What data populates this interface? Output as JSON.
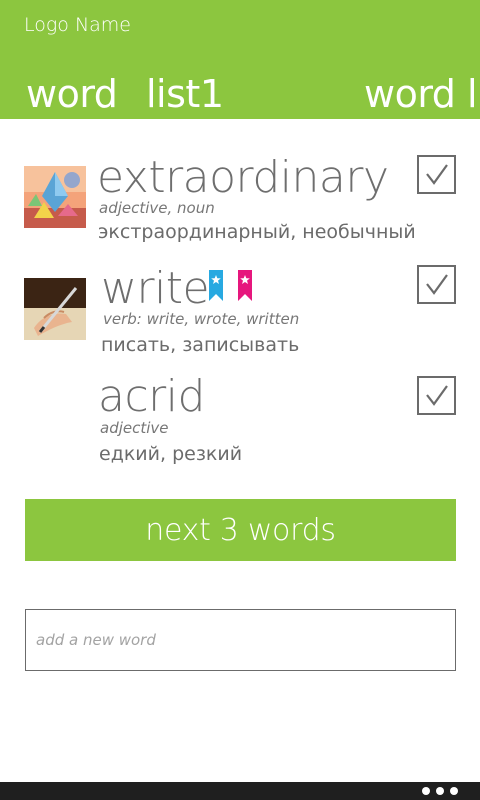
{
  "header": {
    "logo": "Logo Name",
    "pivot": [
      "word",
      "list1",
      "word l"
    ],
    "background_color": "#8cc63f"
  },
  "words": [
    {
      "term": "extraordinary",
      "pos": "adjective, noun",
      "translation": "экстраординарный, необычный",
      "checked": true,
      "image": "triangles-art-thumbnail",
      "bookmarks": []
    },
    {
      "term": "write",
      "pos": "verb: write, wrote, written",
      "translation": "писать, записывать",
      "checked": true,
      "image": "hand-writing-thumbnail",
      "bookmarks": [
        {
          "icon": "star-bookmark-icon",
          "color": "#27a9e1"
        },
        {
          "icon": "star-bookmark-icon",
          "color": "#e6177d"
        }
      ]
    },
    {
      "term": "acrid",
      "pos": "adjective",
      "translation": "едкий, резкий",
      "checked": true,
      "image": null,
      "bookmarks": []
    }
  ],
  "next_button": {
    "label": "next 3 words"
  },
  "add_word": {
    "placeholder": "add a new word",
    "value": ""
  },
  "appbar": {
    "menu_icon": "more-dots-icon",
    "background_color": "#1f1f1f"
  }
}
